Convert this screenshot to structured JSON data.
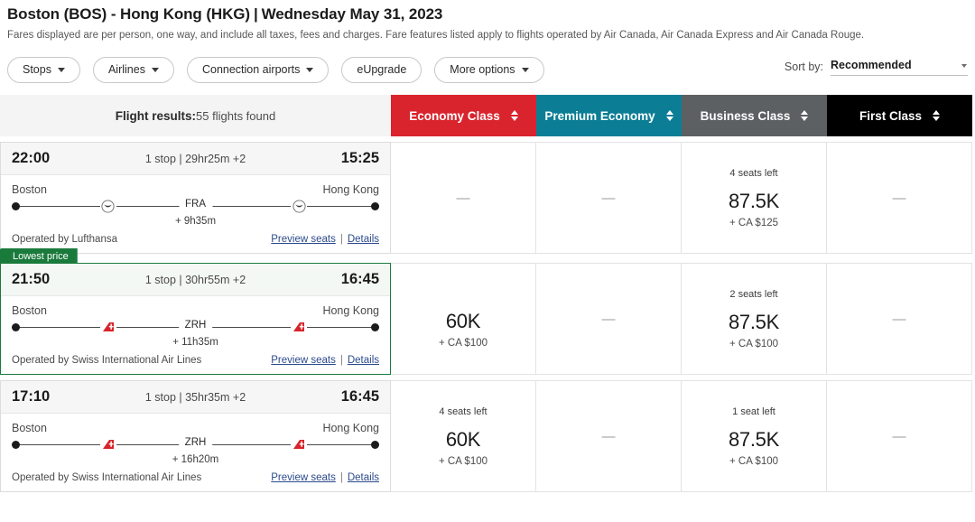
{
  "header": {
    "origin_dest": "Boston (BOS) - Hong Kong (HKG)",
    "separator": "|",
    "date": "Wednesday May 31, 2023",
    "disclaimer": "Fares displayed are per person, one way, and include all taxes, fees and charges. Fare features listed apply to flights operated by Air Canada, Air Canada Express and Air Canada Rouge."
  },
  "filters": [
    {
      "label": "Stops",
      "has_caret": true
    },
    {
      "label": "Airlines",
      "has_caret": true
    },
    {
      "label": "Connection airports",
      "has_caret": true
    },
    {
      "label": "eUpgrade",
      "has_caret": false
    },
    {
      "label": "More options",
      "has_caret": true
    }
  ],
  "sort": {
    "label": "Sort by:",
    "value": "Recommended"
  },
  "results": {
    "label": "Flight results:",
    "count_text": "55 flights found"
  },
  "cabins": [
    {
      "name": "Economy Class",
      "color": "#d9242e"
    },
    {
      "name": "Premium Economy",
      "color": "#0b7e95"
    },
    {
      "name": "Business Class",
      "color": "#5d6063"
    },
    {
      "name": "First Class",
      "color": "#000000"
    }
  ],
  "flights": [
    {
      "badge": null,
      "depart_time": "22:00",
      "arrive_time": "15:25",
      "summary": "1 stop | 29hr25m +2",
      "origin_city": "Boston",
      "dest_city": "Hong Kong",
      "connection": "FRA",
      "layover": "+ 9h35m",
      "operated_by": "Operated by Lufthansa",
      "carrier_icon": "lufthansa-crane-icon",
      "preview_seats": "Preview seats",
      "details": "Details",
      "fares": [
        {
          "seats": null,
          "points": null,
          "cash": null,
          "unavailable": "—"
        },
        {
          "seats": null,
          "points": null,
          "cash": null,
          "unavailable": "—"
        },
        {
          "seats": "4 seats left",
          "points": "87.5K",
          "cash": "+ CA $125",
          "unavailable": null
        },
        {
          "seats": null,
          "points": null,
          "cash": null,
          "unavailable": "—"
        }
      ]
    },
    {
      "badge": "Lowest price",
      "depart_time": "21:50",
      "arrive_time": "16:45",
      "summary": "1 stop | 30hr55m +2",
      "origin_city": "Boston",
      "dest_city": "Hong Kong",
      "connection": "ZRH",
      "layover": "+ 11h35m",
      "operated_by": "Operated by Swiss International Air Lines",
      "carrier_icon": "swiss-tailfin-icon",
      "preview_seats": "Preview seats",
      "details": "Details",
      "fares": [
        {
          "seats": null,
          "points": "60K",
          "cash": "+ CA $100",
          "unavailable": null
        },
        {
          "seats": null,
          "points": null,
          "cash": null,
          "unavailable": "—"
        },
        {
          "seats": "2 seats left",
          "points": "87.5K",
          "cash": "+ CA $100",
          "unavailable": null
        },
        {
          "seats": null,
          "points": null,
          "cash": null,
          "unavailable": "—"
        }
      ]
    },
    {
      "badge": null,
      "depart_time": "17:10",
      "arrive_time": "16:45",
      "summary": "1 stop | 35hr35m +2",
      "origin_city": "Boston",
      "dest_city": "Hong Kong",
      "connection": "ZRH",
      "layover": "+ 16h20m",
      "operated_by": "Operated by Swiss International Air Lines",
      "carrier_icon": "swiss-tailfin-icon",
      "preview_seats": "Preview seats",
      "details": "Details",
      "fares": [
        {
          "seats": "4 seats left",
          "points": "60K",
          "cash": "+ CA $100",
          "unavailable": null
        },
        {
          "seats": null,
          "points": null,
          "cash": null,
          "unavailable": "—"
        },
        {
          "seats": "1 seat left",
          "points": "87.5K",
          "cash": "+ CA $100",
          "unavailable": null
        },
        {
          "seats": null,
          "points": null,
          "cash": null,
          "unavailable": "—"
        }
      ]
    }
  ]
}
